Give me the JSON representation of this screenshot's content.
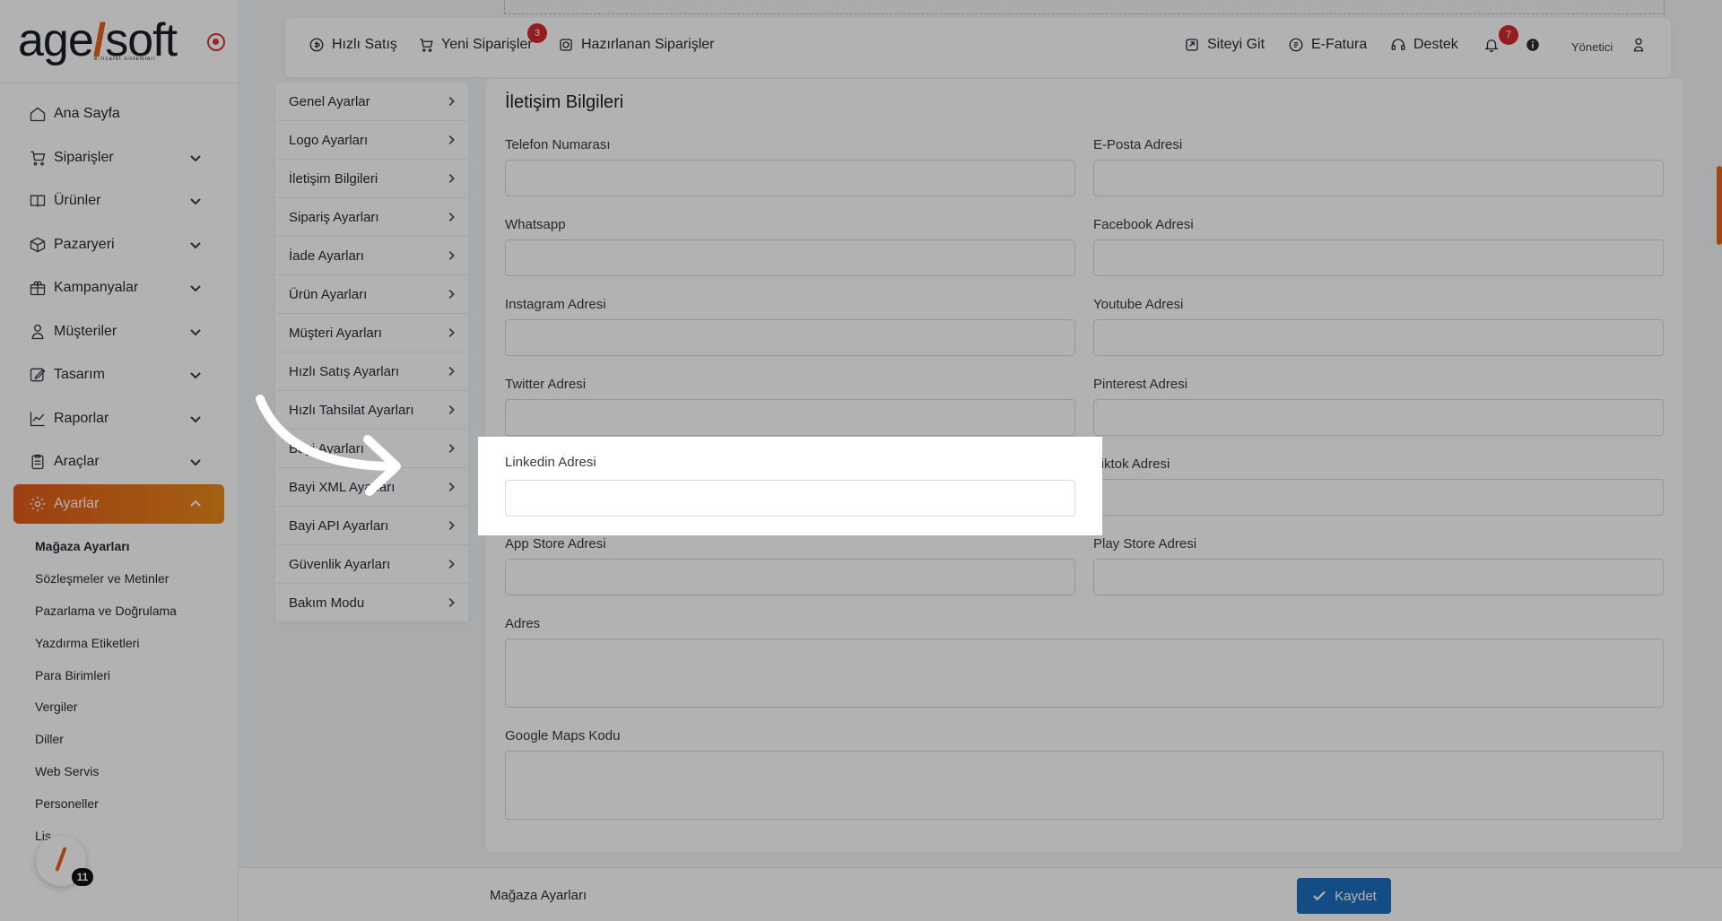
{
  "logo": {
    "text_a": "age",
    "text_b": "soft",
    "sub": "e-ticaret sistemleri"
  },
  "sidebar": {
    "items": [
      {
        "label": "Ana Sayfa",
        "icon": "home-icon"
      },
      {
        "label": "Siparişler",
        "icon": "cart-icon"
      },
      {
        "label": "Ürünler",
        "icon": "book-icon"
      },
      {
        "label": "Pazaryeri",
        "icon": "box-icon"
      },
      {
        "label": "Kampanyalar",
        "icon": "gift-icon"
      },
      {
        "label": "Müşteriler",
        "icon": "user-icon"
      },
      {
        "label": "Tasarım",
        "icon": "edit-icon"
      },
      {
        "label": "Raporlar",
        "icon": "chart-icon"
      },
      {
        "label": "Araçlar",
        "icon": "clipboard-icon"
      },
      {
        "label": "Ayarlar",
        "icon": "gear-icon"
      }
    ],
    "subitems": [
      "Mağaza Ayarları",
      "Sözleşmeler ve Metinler",
      "Pazarlama ve Doğrulama",
      "Yazdırma Etiketleri",
      "Para Birimleri",
      "Vergiler",
      "Diller",
      "Web Servis",
      "Personeller",
      "Lis"
    ],
    "help_badge": "11"
  },
  "topbar": {
    "quick_sale": "Hızlı Satış",
    "new_orders": "Yeni Siparişler",
    "new_orders_badge": "3",
    "prepared_orders": "Hazırlanan Siparişler",
    "go_site": "Siteyi Git",
    "einvoice": "E-Fatura",
    "support": "Destek",
    "notif_badge": "7",
    "user": "Yönetici"
  },
  "settings_menu": [
    "Genel Ayarlar",
    "Logo Ayarları",
    "İletişim Bilgileri",
    "Sipariş Ayarları",
    "İade Ayarları",
    "Ürün Ayarları",
    "Müşteri Ayarları",
    "Hızlı Satış Ayarları",
    "Hızlı Tahsilat Ayarları",
    "Bayi Ayarları",
    "Bayi XML Ayarları",
    "Bayi API Ayarları",
    "Güvenlik Ayarları",
    "Bakım Modu"
  ],
  "form": {
    "title": "İletişim Bilgileri",
    "phone": "Telefon Numarası",
    "email": "E-Posta Adresi",
    "whatsapp": "Whatsapp",
    "facebook": "Facebook Adresi",
    "instagram": "Instagram Adresi",
    "youtube": "Youtube Adresi",
    "twitter": "Twitter Adresi",
    "pinterest": "Pinterest Adresi",
    "linkedin": "Linkedin Adresi",
    "tiktok": "Tiktok Adresi",
    "appstore": "App Store Adresi",
    "playstore": "Play Store Adresi",
    "address": "Adres",
    "maps": "Google Maps Kodu"
  },
  "footer": {
    "title": "Mağaza Ayarları",
    "save": "Kaydet"
  }
}
